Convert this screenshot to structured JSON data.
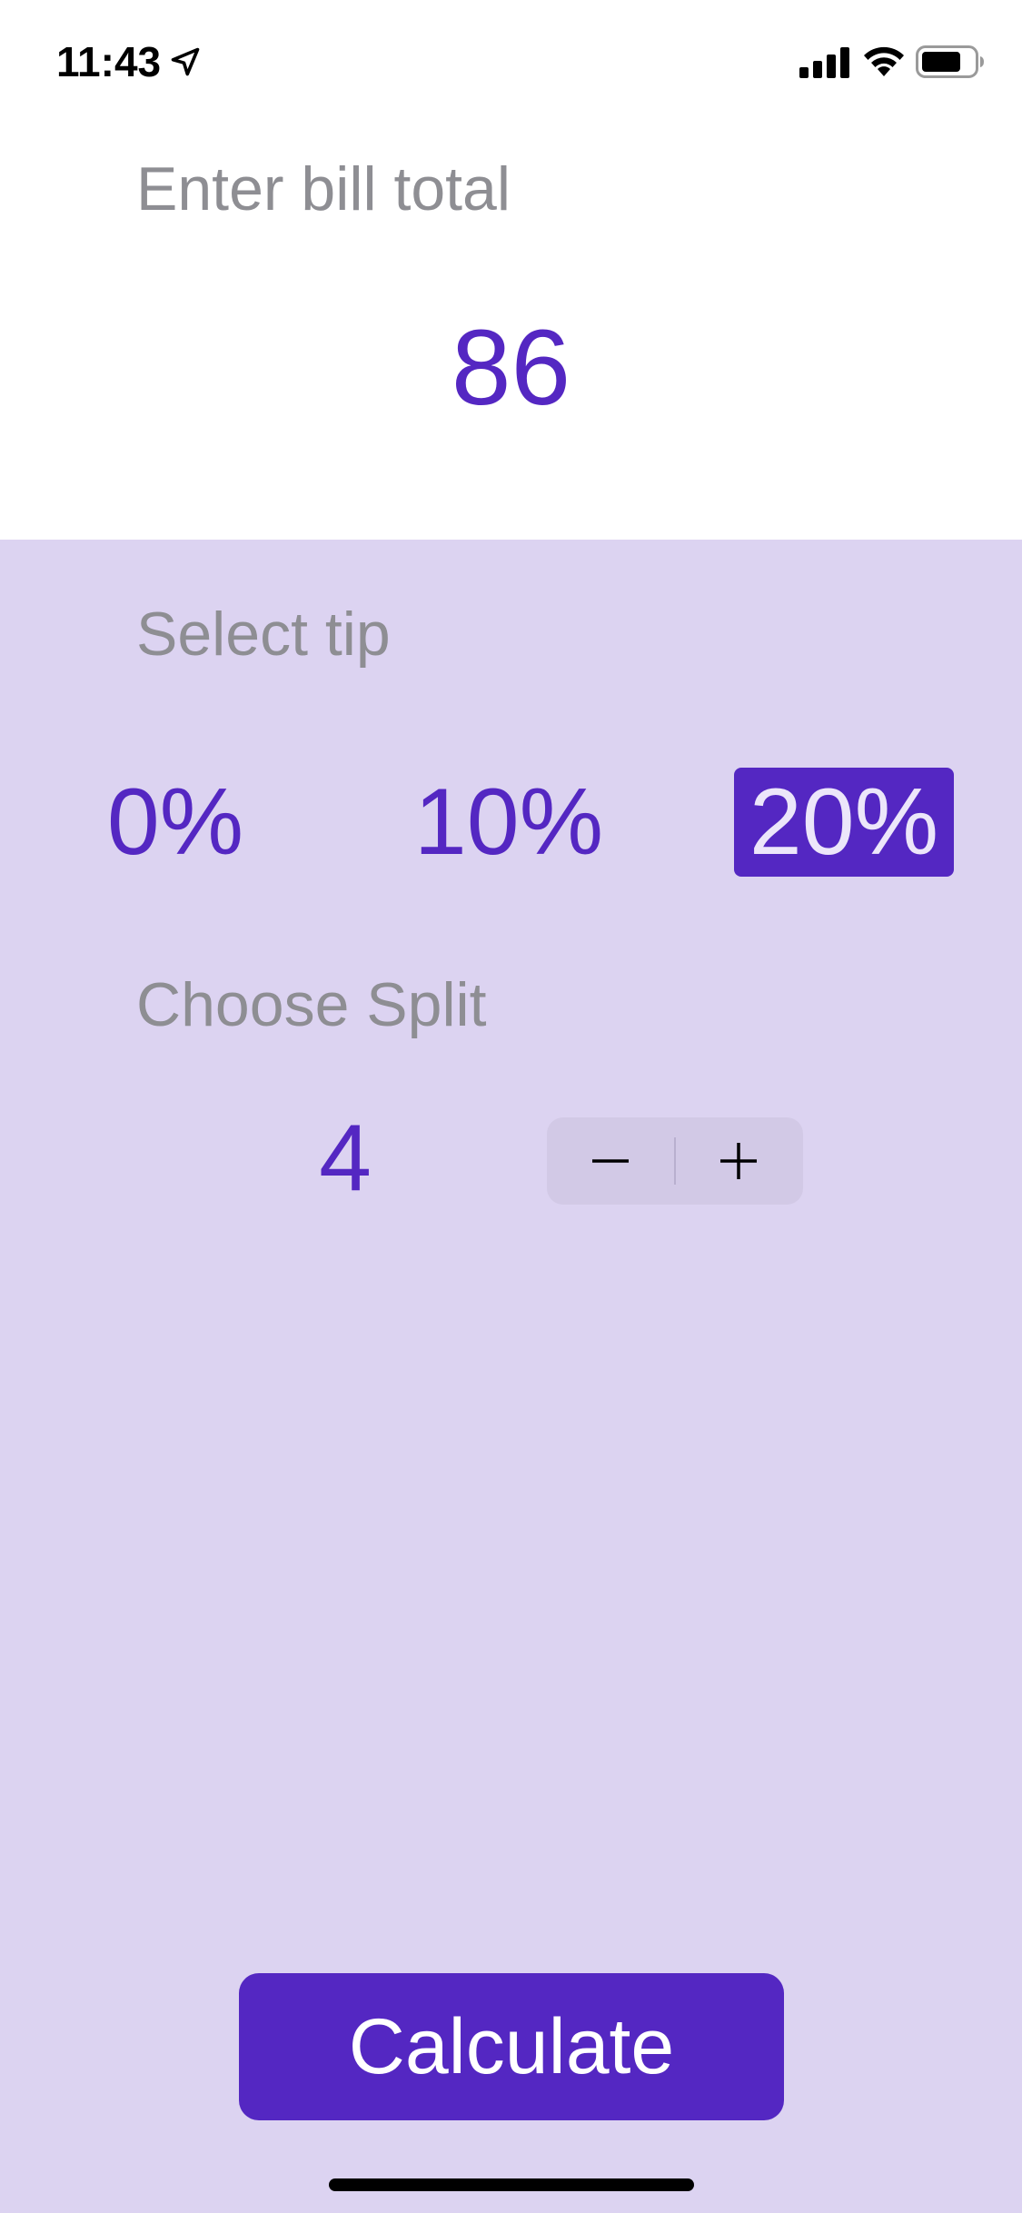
{
  "status_bar": {
    "time": "11:43",
    "location_icon": "location-arrow-icon",
    "signal_icon": "cellular-signal-icon",
    "wifi_icon": "wifi-icon",
    "battery_icon": "battery-icon"
  },
  "bill": {
    "label": "Enter bill total",
    "value": "86"
  },
  "tip": {
    "label": "Select tip",
    "options": [
      "0%",
      "10%",
      "20%"
    ],
    "selected": "20%"
  },
  "split": {
    "label": "Choose Split",
    "value": "4",
    "decrement_icon": "minus-icon",
    "increment_icon": "plus-icon"
  },
  "calculate_label": "Calculate",
  "colors": {
    "accent": "#5427c2",
    "panel_background": "#dcd3f1",
    "label_gray": "#8e8e93"
  }
}
